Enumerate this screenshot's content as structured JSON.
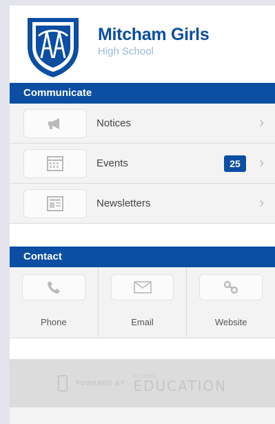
{
  "header": {
    "school_name": "Mitcham Girls",
    "school_sub": "High School"
  },
  "communicate": {
    "title": "Communicate",
    "items": [
      {
        "label": "Notices",
        "icon": "megaphone-icon"
      },
      {
        "label": "Events",
        "icon": "calendar-icon",
        "badge": "25"
      },
      {
        "label": "Newsletters",
        "icon": "newsletter-icon"
      }
    ]
  },
  "contact": {
    "title": "Contact",
    "items": [
      {
        "label": "Phone",
        "icon": "phone-icon"
      },
      {
        "label": "Email",
        "icon": "envelope-icon"
      },
      {
        "label": "Website",
        "icon": "link-icon"
      }
    ]
  },
  "footer": {
    "powered_by": "POWERED BY",
    "brand_top": "SCHOOL",
    "brand": "EDUCATION"
  },
  "colors": {
    "brand_blue": "#0b4ea2",
    "light_blue": "#9bb8db"
  }
}
